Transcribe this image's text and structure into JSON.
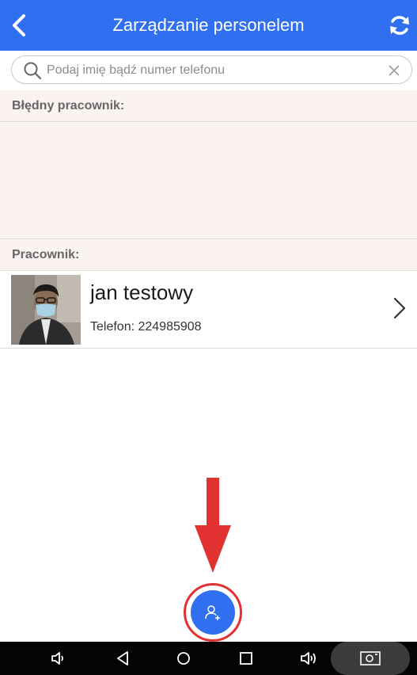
{
  "header": {
    "title": "Zarządzanie personelem"
  },
  "search": {
    "placeholder": "Podaj imię bądź numer telefonu",
    "value": ""
  },
  "sections": {
    "error_employee_label": "Błędny pracownik:",
    "employee_label": "Pracownik:"
  },
  "employees": [
    {
      "name": "jan testowy",
      "phone": "Telefon: 224985908"
    }
  ],
  "colors": {
    "appbar": "#2f6ff0",
    "section_bg": "#fbf3f1",
    "annotation": "#e23131",
    "navbar": "#050505"
  },
  "icons": {
    "back": "chevron-left-icon",
    "refresh": "refresh-icon",
    "search": "search-icon",
    "clear": "close-icon",
    "row_chevron": "chevron-right-icon",
    "fab": "add-user-icon",
    "nav": [
      "volume-down-icon",
      "back-triangle-icon",
      "home-circle-icon",
      "recents-square-icon",
      "volume-up-icon",
      "screenshot-icon"
    ]
  }
}
